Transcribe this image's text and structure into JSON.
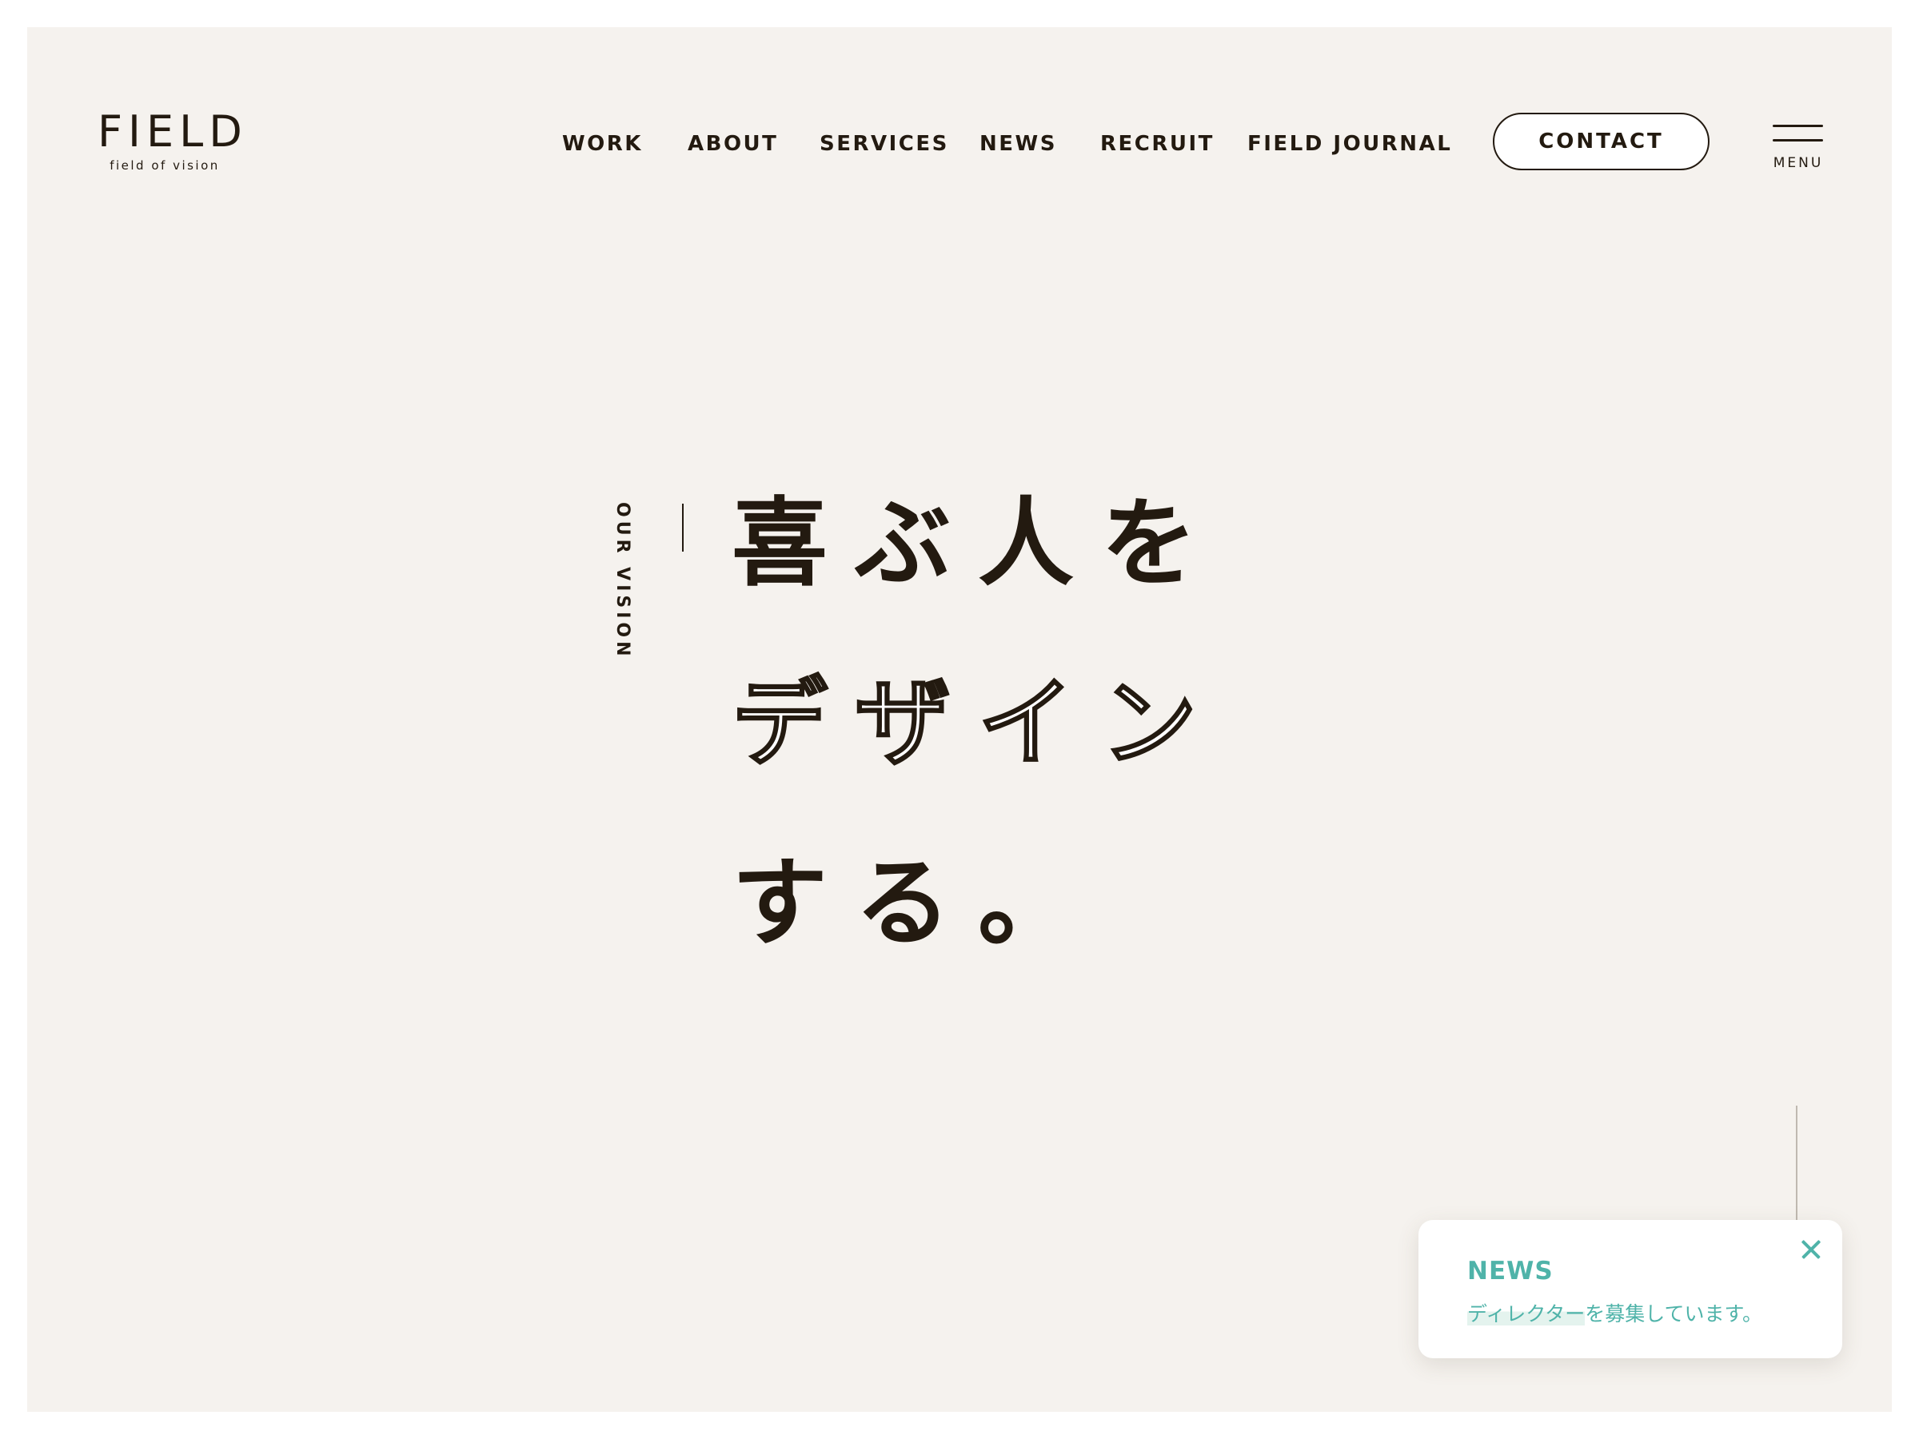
{
  "logo": {
    "main": "FIELD",
    "tagline": "field of vision"
  },
  "nav": {
    "items": [
      {
        "label": "WORK"
      },
      {
        "label": "ABOUT"
      },
      {
        "label": "SERVICES"
      },
      {
        "label": "NEWS"
      },
      {
        "label": "RECRUIT"
      },
      {
        "label": "FIELD JOURNAL"
      }
    ],
    "contact_label": "CONTACT",
    "menu_label": "MENU"
  },
  "hero": {
    "section_label": "OUR VISION",
    "lines": [
      {
        "text": "喜ぶ人を",
        "style": "solid"
      },
      {
        "text": "デザイン",
        "style": "outline"
      },
      {
        "text": "する。",
        "style": "solid"
      }
    ]
  },
  "news_popup": {
    "title": "NEWS",
    "highlight_text": "ディレクター",
    "rest_text": "を募集しています。",
    "close_icon": "close-icon"
  },
  "colors": {
    "background": "#f5f2ee",
    "text": "#231a10",
    "accent": "#4fb3a9",
    "highlight": "#e4f3ee"
  }
}
